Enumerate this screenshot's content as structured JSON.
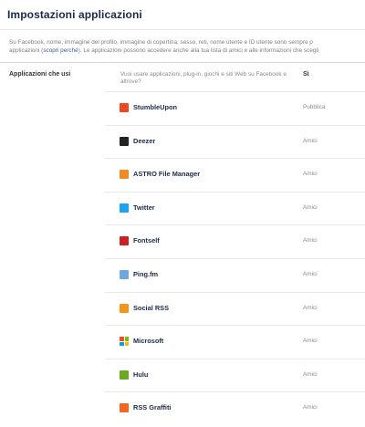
{
  "page": {
    "title": "Impostazioni applicazioni",
    "intro_line1": "Su Facebook, nome, immagine del profilo, immagine di copertina, sesso, reti, nome utente e ID utente sono sempre p",
    "intro_line2_start": "applicazioni (",
    "intro_link": "scopri perché",
    "intro_line2_end": "). Le applicazioni possono accedere anche alla tua lista di amici e alle informazioni che scegli"
  },
  "section": {
    "label": "Applicazioni che usi",
    "question": "Vuoi usare applicazioni, plug-in, giochi e siti Web su Facebook e altrove?",
    "answer": "Sì"
  },
  "apps": [
    {
      "name": "StumbleUpon",
      "audience": "Pubblica",
      "icon": "stumbleupon-icon",
      "color": "#eb4823"
    },
    {
      "name": "Deezer",
      "audience": "Amici",
      "icon": "deezer-icon",
      "color": "#222222"
    },
    {
      "name": "ASTRO File Manager",
      "audience": "Amici",
      "icon": "astro-icon",
      "color": "#f08a24"
    },
    {
      "name": "Twitter",
      "audience": "Amici",
      "icon": "twitter-icon",
      "color": "#1da1f2"
    },
    {
      "name": "Fontself",
      "audience": "Amici",
      "icon": "fontself-icon",
      "color": "#cc1f1f"
    },
    {
      "name": "Ping.fm",
      "audience": "Amici",
      "icon": "pingfm-icon",
      "color": "#6fa8dc"
    },
    {
      "name": "Social RSS",
      "audience": "Amici",
      "icon": "rss-icon",
      "color": "#f7941d"
    },
    {
      "name": "Microsoft",
      "audience": "Amici",
      "icon": "microsoft-icon",
      "color": "#737373"
    },
    {
      "name": "Hulu",
      "audience": "Amici",
      "icon": "hulu-icon",
      "color": "#6aaa1e"
    },
    {
      "name": "RSS Graffiti",
      "audience": "Amici",
      "icon": "rss-graffiti-icon",
      "color": "#f26522"
    }
  ]
}
